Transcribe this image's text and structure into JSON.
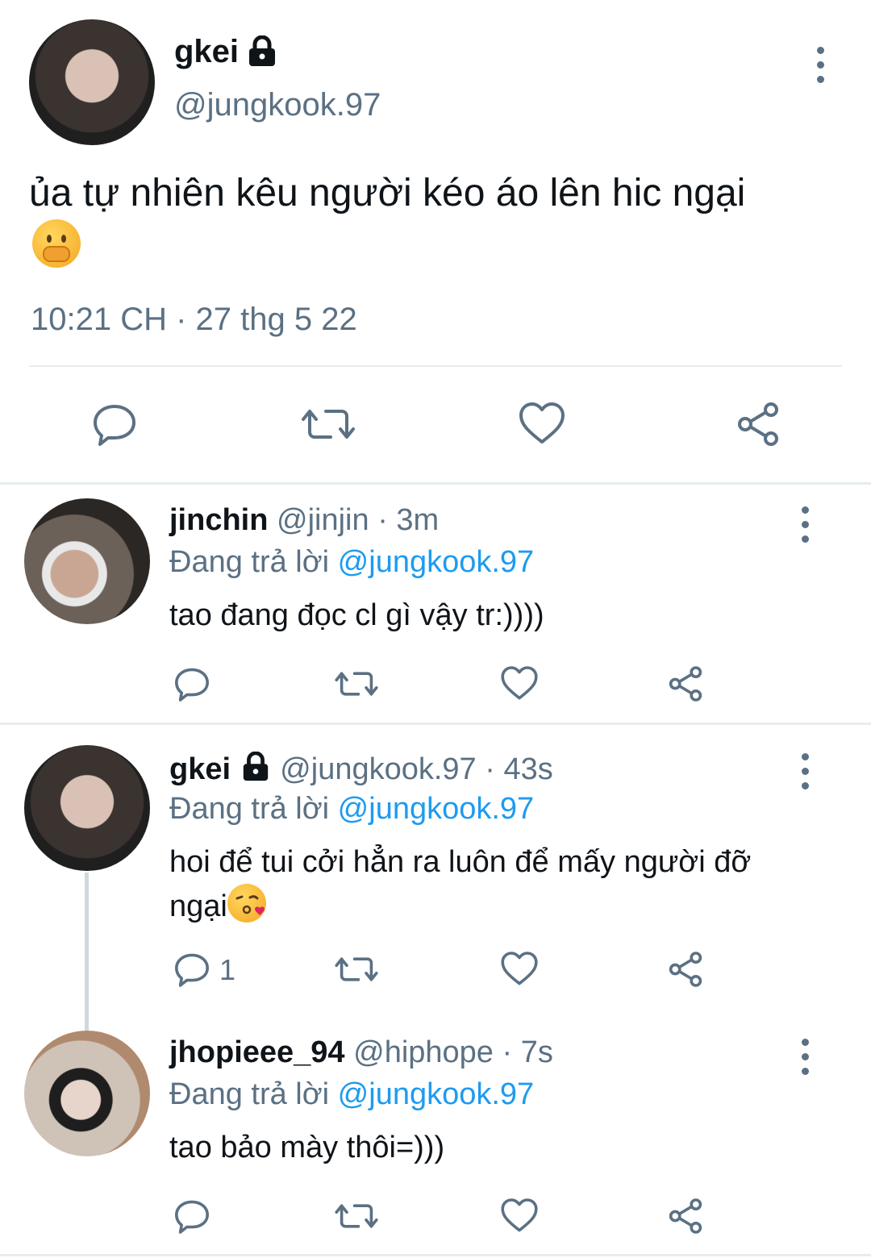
{
  "main_tweet": {
    "display_name": "gkei",
    "handle": "@jungkook.97",
    "text": "ủa tự nhiên kêu người kéo áo lên hic ngại",
    "timestamp": "10:21 CH · 27 thg 5 22",
    "emoji": "hand-over-mouth-emoji",
    "locked_icon": "lock-icon"
  },
  "replies": [
    {
      "display_name": "jinchin",
      "handle": "@jinjin",
      "time": "· 3m",
      "replying_label": "Đang trả lời",
      "replying_to": "@jungkook.97",
      "text": "tao đang đọc cl gì vậy tr:))))",
      "reply_count": ""
    },
    {
      "display_name": "gkei",
      "handle": "@jungkook.97",
      "time": "· 43s",
      "replying_label": "Đang trả lời",
      "replying_to": "@jungkook.97",
      "text_line1": "hoi để tui cởi hẳn ra luôn để mấy người đỡ",
      "text_line2": "ngại",
      "emoji": "kissing-face-emoji",
      "reply_count": "1"
    },
    {
      "display_name": "jhopieee_94",
      "handle": "@hiphope",
      "time": "· 7s",
      "replying_label": "Đang trả lời",
      "replying_to": "@jungkook.97",
      "text": "tao bảo mày thôi=)))",
      "reply_count": ""
    }
  ],
  "colors": {
    "accent": "#1d9bf0",
    "secondary_text": "#5b7083",
    "separator": "#e6ecf0"
  }
}
